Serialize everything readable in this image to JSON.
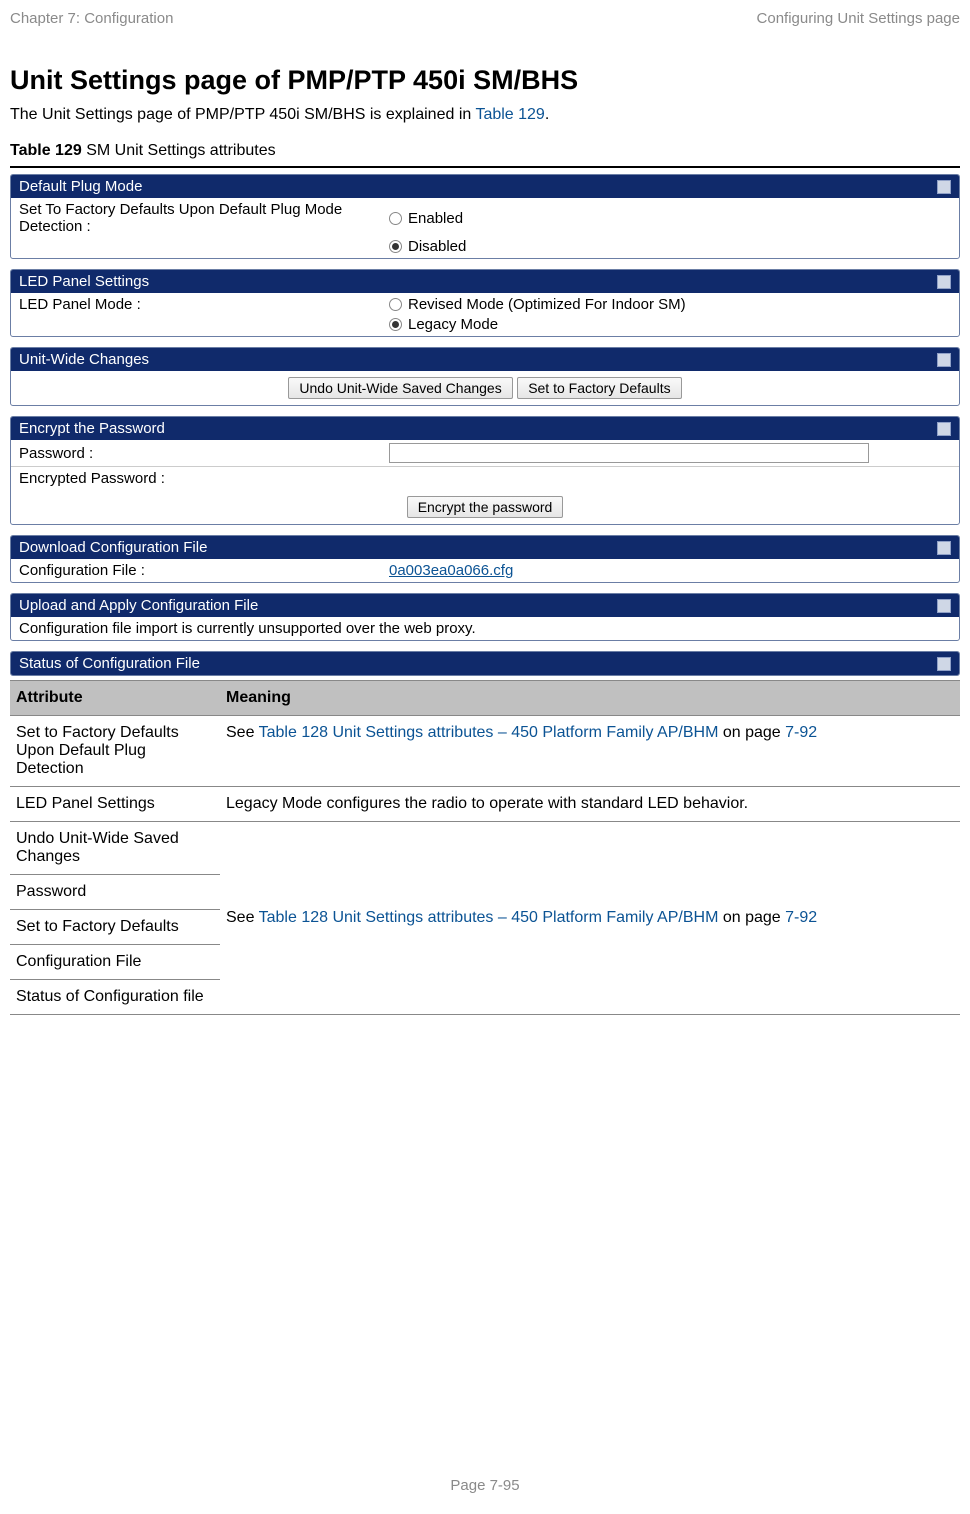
{
  "header": {
    "left": "Chapter 7:  Configuration",
    "right": "Configuring Unit Settings page"
  },
  "title": "Unit Settings page of PMP/PTP 450i SM/BHS",
  "intro_pre": "The Unit Settings page of PMP/PTP 450i SM/BHS is explained in ",
  "intro_link": "Table 129",
  "intro_post": ".",
  "table_caption_bold": "Table 129",
  "table_caption_rest": " SM Unit Settings attributes",
  "panels": {
    "default_plug": {
      "title": "Default Plug Mode",
      "row_label": "Set To Factory Defaults Upon Default Plug Mode Detection :",
      "opt1": "Enabled",
      "opt2": "Disabled"
    },
    "led": {
      "title": "LED Panel Settings",
      "row_label": "LED Panel Mode :",
      "opt1": "Revised Mode (Optimized For Indoor SM)",
      "opt2": "Legacy Mode"
    },
    "unitwide": {
      "title": "Unit-Wide Changes",
      "btn1": "Undo Unit-Wide Saved Changes",
      "btn2": "Set to Factory Defaults"
    },
    "encrypt": {
      "title": "Encrypt the Password",
      "lbl1": "Password :",
      "lbl2": "Encrypted Password :",
      "btn": "Encrypt the password"
    },
    "download": {
      "title": "Download Configuration File",
      "lbl": "Configuration File :",
      "file": "0a003ea0a066.cfg"
    },
    "upload": {
      "title": "Upload and Apply Configuration File",
      "msg": "Configuration file import is currently unsupported over the web proxy."
    },
    "status": {
      "title": "Status of Configuration File"
    }
  },
  "attr_header": {
    "c1": "Attribute",
    "c2": "Meaning"
  },
  "attrs": {
    "r1c1": "Set to Factory Defaults Upon Default Plug Detection",
    "r1c2_pre": "See ",
    "r1c2_link": "Table 128 Unit Settings attributes – 450 Platform Family AP/BHM",
    "r1c2_mid": " on page ",
    "r1c2_page": "7-92",
    "r2c1": "LED Panel Settings",
    "r2c2": "Legacy Mode configures the radio to operate with standard LED behavior.",
    "r3c1": "Undo Unit-Wide Saved Changes",
    "r4c1": "Password",
    "r5c1": "Set to Factory Defaults",
    "r6c1": "Configuration File",
    "r7c1": "Status of Configuration file",
    "multi_c2_pre": "See ",
    "multi_c2_link": "Table 128 Unit Settings attributes – 450 Platform Family AP/BHM",
    "multi_c2_mid": " on page ",
    "multi_c2_page": "7-92"
  },
  "footer": "Page 7-95"
}
